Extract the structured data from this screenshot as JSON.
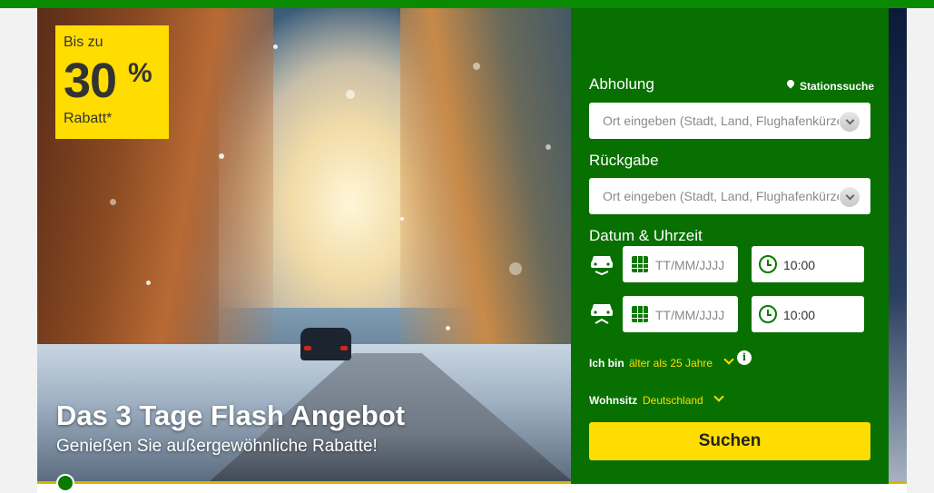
{
  "promo": {
    "prefix": "Bis zu",
    "number": "30",
    "percent": "%",
    "suffix": "Rabatt*"
  },
  "hero": {
    "headline": "Das 3 Tage Flash Angebot",
    "subline": "Genießen Sie außergewöhnliche Rabatte!"
  },
  "form": {
    "pickup_label": "Abholung",
    "station_search": "Stationssuche",
    "pickup_placeholder": "Ort eingeben (Stadt, Land, Flughafenkürzel)",
    "return_label": "Rückgabe",
    "return_placeholder": "Ort eingeben (Stadt, Land, Flughafenkürzel)",
    "datetime_label": "Datum & Uhrzeit",
    "pickup_date_placeholder": "TT/MM/JJJJ",
    "pickup_time": "10:00",
    "return_date_placeholder": "TT/MM/JJJJ",
    "return_time": "10:00",
    "age_label": "Ich bin",
    "age_value": "älter als 25 Jahre",
    "info_icon": "i",
    "residence_label": "Wohnsitz",
    "residence_value": "Deutschland",
    "search_button": "Suchen"
  },
  "colors": {
    "brand_green": "#087000",
    "accent_yellow": "#ffdd00",
    "top_bar": "#0a8a00"
  },
  "icons": [
    "map-pin-icon",
    "chevron-down-icon",
    "car-pickup-icon",
    "car-return-icon",
    "calendar-icon",
    "clock-icon",
    "info-icon"
  ]
}
